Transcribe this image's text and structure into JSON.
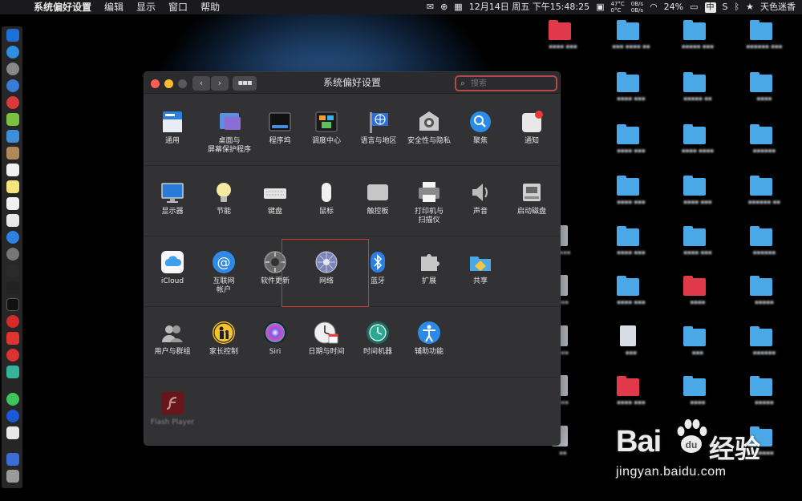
{
  "menubar": {
    "app_name": "系统偏好设置",
    "menus": [
      "编辑",
      "显示",
      "窗口",
      "帮助"
    ],
    "status": {
      "date_time": "12月14日 周五 下午15:48:25",
      "temperature": "47°C",
      "temperature_sub": "0°C",
      "net_up": "0B/s",
      "net_down": "0B/s",
      "battery": "24%",
      "ime": "中",
      "user": "天色迷香"
    }
  },
  "window": {
    "title": "系统偏好设置",
    "search_placeholder": "搜索",
    "sections": [
      {
        "items": [
          {
            "label": "通用",
            "icon": "general-icon"
          },
          {
            "label": "桌面与\n屏幕保护程序",
            "icon": "desktop-screensaver-icon"
          },
          {
            "label": "程序坞",
            "icon": "dock-icon"
          },
          {
            "label": "调度中心",
            "icon": "mission-control-icon"
          },
          {
            "label": "语言与地区",
            "icon": "language-region-icon"
          },
          {
            "label": "安全性与隐私",
            "icon": "security-privacy-icon"
          },
          {
            "label": "聚焦",
            "icon": "spotlight-icon"
          },
          {
            "label": "通知",
            "icon": "notifications-icon"
          }
        ]
      },
      {
        "items": [
          {
            "label": "显示器",
            "icon": "displays-icon"
          },
          {
            "label": "节能",
            "icon": "energy-saver-icon"
          },
          {
            "label": "键盘",
            "icon": "keyboard-icon"
          },
          {
            "label": "鼠标",
            "icon": "mouse-icon"
          },
          {
            "label": "触控板",
            "icon": "trackpad-icon"
          },
          {
            "label": "打印机与\n扫描仪",
            "icon": "printers-scanners-icon"
          },
          {
            "label": "声音",
            "icon": "sound-icon"
          },
          {
            "label": "启动磁盘",
            "icon": "startup-disk-icon"
          }
        ]
      },
      {
        "items": [
          {
            "label": "iCloud",
            "icon": "icloud-icon"
          },
          {
            "label": "互联网\n帐户",
            "icon": "internet-accounts-icon"
          },
          {
            "label": "软件更新",
            "icon": "software-update-icon"
          },
          {
            "label": "网络",
            "icon": "network-icon"
          },
          {
            "label": "蓝牙",
            "icon": "bluetooth-icon"
          },
          {
            "label": "扩展",
            "icon": "extensions-icon"
          },
          {
            "label": "共享",
            "icon": "sharing-icon"
          }
        ]
      },
      {
        "items": [
          {
            "label": "用户与群组",
            "icon": "users-groups-icon"
          },
          {
            "label": "家长控制",
            "icon": "parental-controls-icon"
          },
          {
            "label": "Siri",
            "icon": "siri-icon"
          },
          {
            "label": "日期与时间",
            "icon": "date-time-icon"
          },
          {
            "label": "时间机器",
            "icon": "time-machine-icon"
          },
          {
            "label": "辅助功能",
            "icon": "accessibility-icon"
          }
        ]
      },
      {
        "items": [
          {
            "label": "Flash Player",
            "icon": "flash-player-icon"
          }
        ]
      }
    ],
    "highlighted_item": "网络"
  },
  "watermark": {
    "brand_left": "Bai",
    "brand_right": "经验",
    "url": "jingyan.baidu.com"
  },
  "colors": {
    "menubar": "#1a1a1c",
    "window_bg": "#323234",
    "highlight_border": "#d8342c",
    "folder_blue": "#4aa8e6"
  }
}
